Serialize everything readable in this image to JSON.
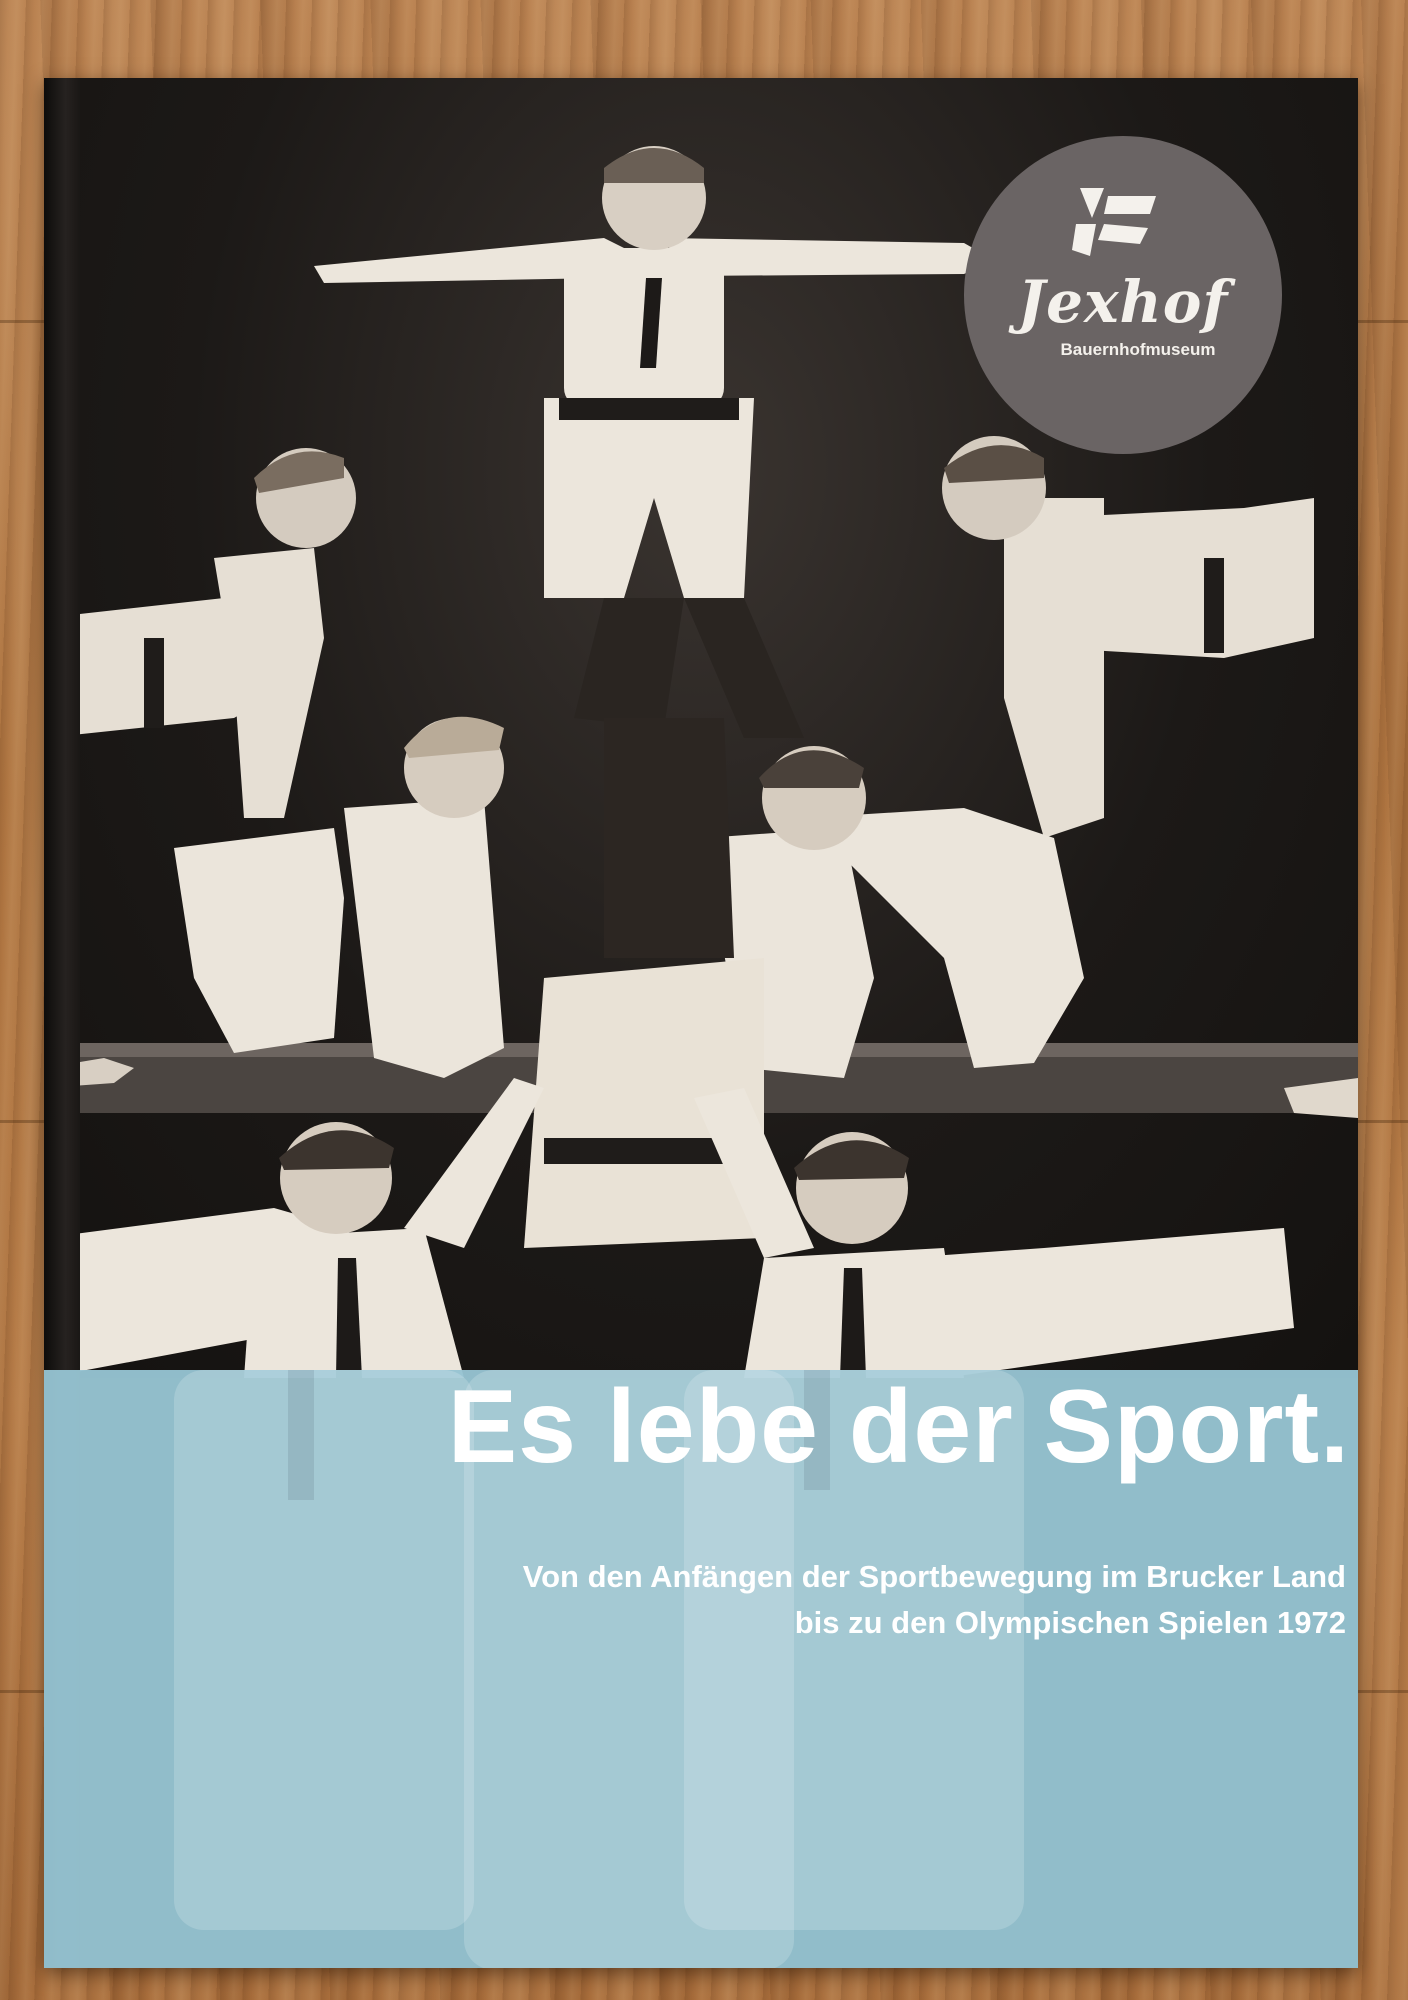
{
  "cover": {
    "title": "Es lebe der Sport.",
    "subtitle_line1": "Von den Anfängen der Sportbewegung im Brucker Land",
    "subtitle_line2": "bis zu den Olympischen Spielen 1972"
  },
  "logo": {
    "name": "Jexhof",
    "tagline": "Bauernhofmuseum"
  },
  "colors": {
    "band": "#96c4d2",
    "logo_circle": "#6a6464",
    "text": "#ffffff"
  }
}
